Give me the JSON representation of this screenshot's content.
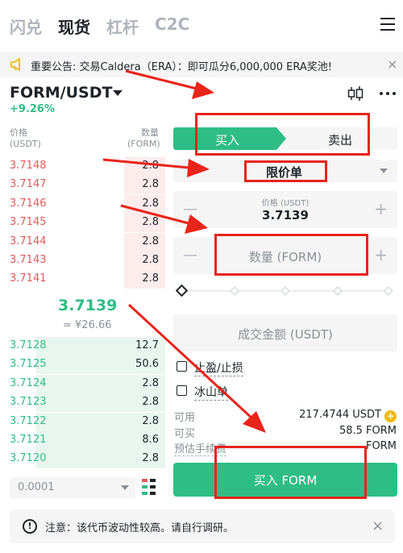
{
  "nav": {
    "tabs": [
      "闪兑",
      "现货",
      "杠杆",
      "C2C"
    ],
    "active_tab": "现货"
  },
  "announcement": {
    "text": "重要公告: 交易Caldera（ERA）：即可瓜分6,000,000 ERA奖池!",
    "close": "×"
  },
  "pair": {
    "symbol": "FORM/USDT",
    "change": "+9.26%"
  },
  "orderbook": {
    "price_header": [
      "价格",
      "(USDT)"
    ],
    "qty_header": [
      "数量",
      "(FORM)"
    ],
    "asks": [
      {
        "price": "3.7148",
        "qty": "2.8",
        "depth": 0.25
      },
      {
        "price": "3.7147",
        "qty": "2.8",
        "depth": 0.25
      },
      {
        "price": "3.7146",
        "qty": "2.8",
        "depth": 0.25
      },
      {
        "price": "3.7145",
        "qty": "2.8",
        "depth": 0.25
      },
      {
        "price": "3.7144",
        "qty": "2.8",
        "depth": 0.25
      },
      {
        "price": "3.7143",
        "qty": "2.8",
        "depth": 0.25
      },
      {
        "price": "3.7141",
        "qty": "2.8",
        "depth": 0.25
      }
    ],
    "mid_price": "3.7139",
    "mid_fiat": "≈ ¥26.66",
    "bids": [
      {
        "price": "3.7128",
        "qty": "12.7",
        "depth": 0.78
      },
      {
        "price": "3.7125",
        "qty": "50.6",
        "depth": 0.78
      },
      {
        "price": "3.7124",
        "qty": "2.8",
        "depth": 0.78
      },
      {
        "price": "3.7123",
        "qty": "2.8",
        "depth": 0.78
      },
      {
        "price": "3.7122",
        "qty": "2.8",
        "depth": 0.78
      },
      {
        "price": "3.7121",
        "qty": "8.6",
        "depth": 0.78
      },
      {
        "price": "3.7120",
        "qty": "2.8",
        "depth": 0.78
      }
    ],
    "tick_size": "0.0001"
  },
  "trade": {
    "buy_tab": "买入",
    "sell_tab": "卖出",
    "order_type": "限价单",
    "price_label": "价格 (USDT)",
    "price_value": "3.7139",
    "qty_placeholder": "数量 (FORM)",
    "amount_placeholder": "成交金额 (USDT)",
    "slider_percent": 0,
    "tp_sl_label": "止盈/止损",
    "iceberg_label": "冰山单",
    "available_label": "可用",
    "available_value": "217.4744 USDT",
    "can_buy_label": "可买",
    "can_buy_value": "58.5 FORM",
    "fee_label": "预估手续费",
    "fee_value": "FORM",
    "buy_button": "买入 FORM"
  },
  "warning": {
    "text": "注意：该代币波动性较高。请自行调研。",
    "close": "×"
  },
  "colors": {
    "green": "#2ebd85",
    "red": "#e15a5a",
    "annotation": "#e8241b"
  }
}
